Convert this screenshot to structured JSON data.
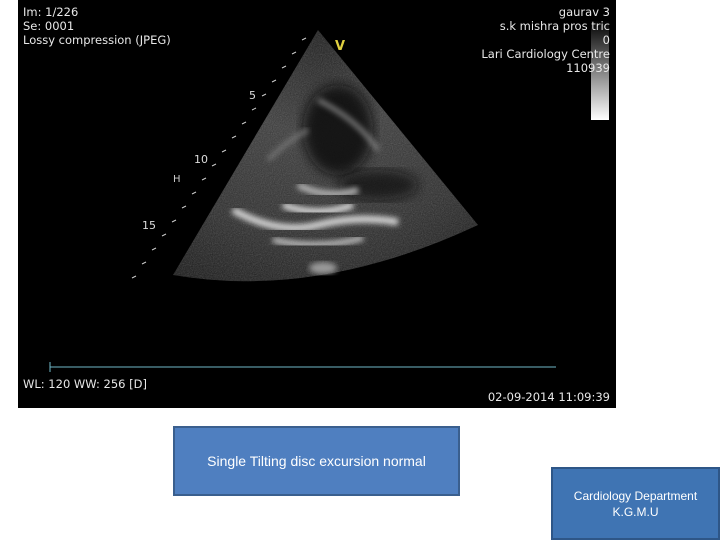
{
  "overlay_left": {
    "line1": "Im: 1/226",
    "line2": "Se: 0001",
    "line3": "Lossy compression (JPEG)"
  },
  "overlay_right": {
    "line1": "gaurav 3",
    "line2": "s.k mishra pros tric",
    "line3": "0",
    "line4": "Lari Cardiology Centre",
    "line5": "110939"
  },
  "window_level": "WL: 120 WW: 256 [D]",
  "datetime": "02-09-2014 11:09:39",
  "depth_labels": [
    "5",
    "10",
    "15"
  ],
  "probe_marker": "V",
  "caption": "Single Tilting disc excursion normal",
  "department": {
    "line1": "Cardiology Department",
    "line2": "K.G.M.U"
  },
  "colors": {
    "caption_bg": "#4f7fc0",
    "dept_bg": "#3f74b3",
    "scale_line": "#6fb7c8"
  }
}
